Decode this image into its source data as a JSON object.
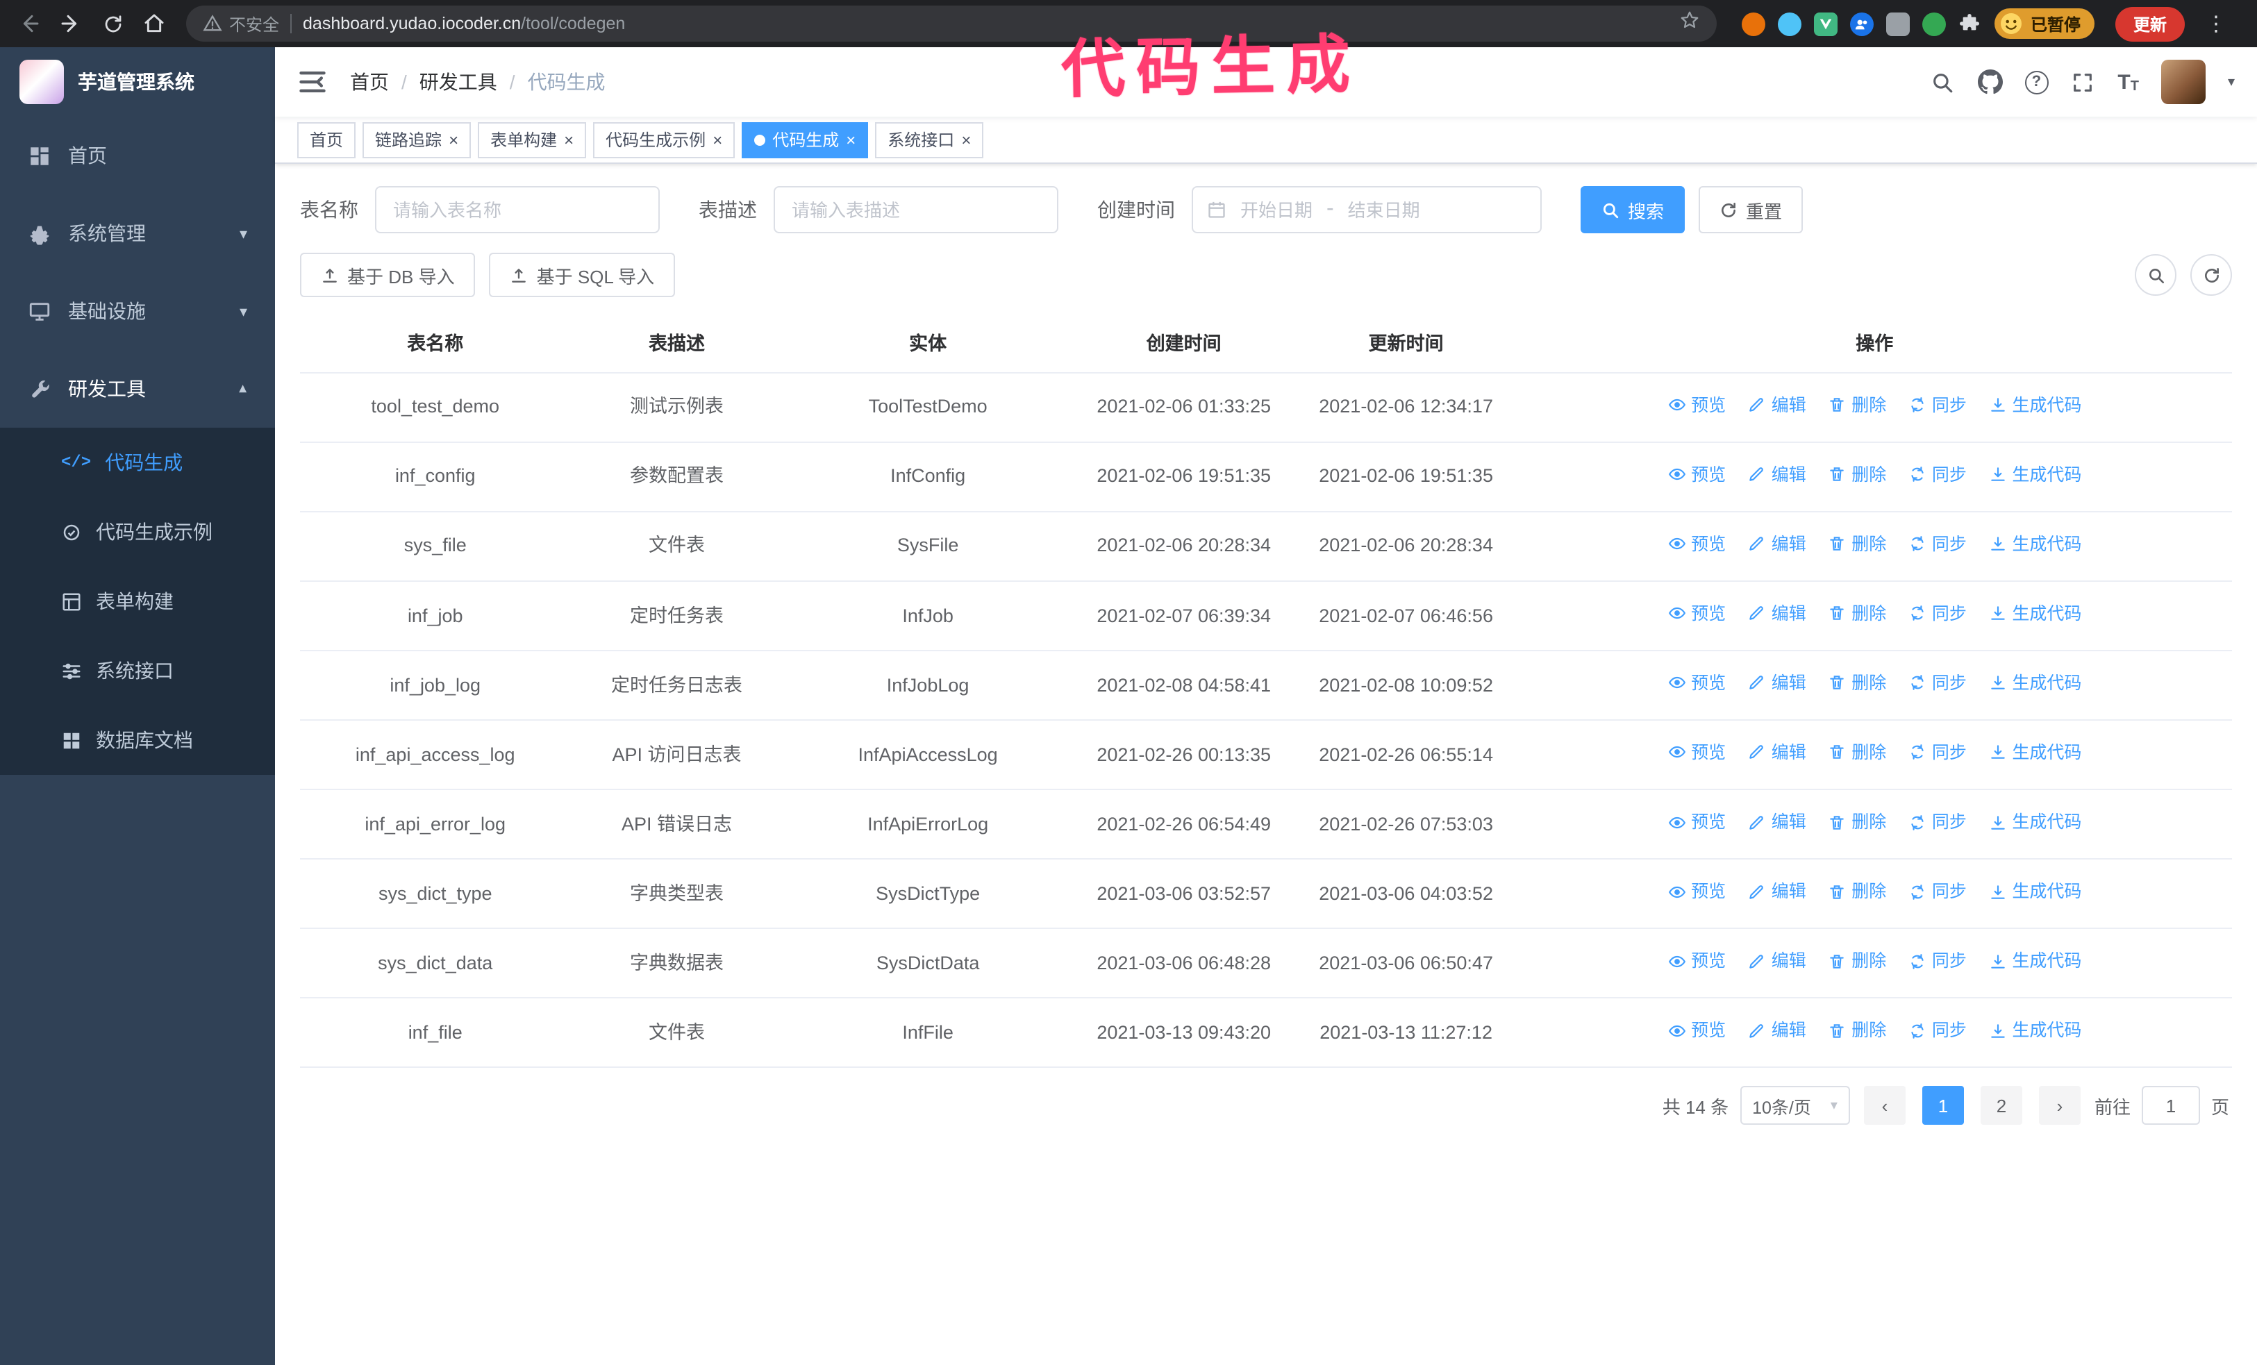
{
  "annotation": {
    "text": "代码生成"
  },
  "icons": {
    "close": "×",
    "kebab": "⋮",
    "caret_down": "▾",
    "code": "</>",
    "question": "?",
    "text_size": "T",
    "prev": "‹",
    "next": "›"
  },
  "browser": {
    "security_label": "不安全",
    "url_domain": "dashboard.yudao.iocoder.cn",
    "url_path": "/tool/codegen",
    "paused_badge": "已暂停",
    "update_button": "更新"
  },
  "sidebar": {
    "logo_title": "芋道管理系统",
    "items": [
      {
        "label": "首页"
      },
      {
        "label": "系统管理"
      },
      {
        "label": "基础设施"
      },
      {
        "label": "研发工具"
      }
    ],
    "submenu": [
      {
        "label": "代码生成"
      },
      {
        "label": "代码生成示例"
      },
      {
        "label": "表单构建"
      },
      {
        "label": "系统接口"
      },
      {
        "label": "数据库文档"
      }
    ]
  },
  "navbar": {
    "breadcrumb": [
      "首页",
      "研发工具",
      "代码生成"
    ],
    "breadcrumb_separator": "/"
  },
  "tags": [
    {
      "label": "首页"
    },
    {
      "label": "链路追踪"
    },
    {
      "label": "表单构建"
    },
    {
      "label": "代码生成示例"
    },
    {
      "label": "代码生成"
    },
    {
      "label": "系统接口"
    }
  ],
  "search_form": {
    "table_name_label": "表名称",
    "table_name_placeholder": "请输入表名称",
    "table_desc_label": "表描述",
    "table_desc_placeholder": "请输入表描述",
    "create_time_label": "创建时间",
    "date_start_placeholder": "开始日期",
    "date_separator": "-",
    "date_end_placeholder": "结束日期",
    "search_button": "搜索",
    "reset_button": "重置"
  },
  "toolbar": {
    "import_db_button": "基于 DB 导入",
    "import_sql_button": "基于 SQL 导入"
  },
  "table": {
    "columns": [
      "表名称",
      "表描述",
      "实体",
      "创建时间",
      "更新时间",
      "操作"
    ],
    "actions": [
      "预览",
      "编辑",
      "删除",
      "同步",
      "生成代码"
    ],
    "rows": [
      {
        "name": "tool_test_demo",
        "desc": "测试示例表",
        "entity": "ToolTestDemo",
        "created": "2021-02-06 01:33:25",
        "updated": "2021-02-06 12:34:17"
      },
      {
        "name": "inf_config",
        "desc": "参数配置表",
        "entity": "InfConfig",
        "created": "2021-02-06 19:51:35",
        "updated": "2021-02-06 19:51:35"
      },
      {
        "name": "sys_file",
        "desc": "文件表",
        "entity": "SysFile",
        "created": "2021-02-06 20:28:34",
        "updated": "2021-02-06 20:28:34"
      },
      {
        "name": "inf_job",
        "desc": "定时任务表",
        "entity": "InfJob",
        "created": "2021-02-07 06:39:34",
        "updated": "2021-02-07 06:46:56"
      },
      {
        "name": "inf_job_log",
        "desc": "定时任务日志表",
        "entity": "InfJobLog",
        "created": "2021-02-08 04:58:41",
        "updated": "2021-02-08 10:09:52"
      },
      {
        "name": "inf_api_access_log",
        "desc": "API 访问日志表",
        "entity": "InfApiAccessLog",
        "created": "2021-02-26 00:13:35",
        "updated": "2021-02-26 06:55:14"
      },
      {
        "name": "inf_api_error_log",
        "desc": "API 错误日志",
        "entity": "InfApiErrorLog",
        "created": "2021-02-26 06:54:49",
        "updated": "2021-02-26 07:53:03"
      },
      {
        "name": "sys_dict_type",
        "desc": "字典类型表",
        "entity": "SysDictType",
        "created": "2021-03-06 03:52:57",
        "updated": "2021-03-06 04:03:52"
      },
      {
        "name": "sys_dict_data",
        "desc": "字典数据表",
        "entity": "SysDictData",
        "created": "2021-03-06 06:48:28",
        "updated": "2021-03-06 06:50:47"
      },
      {
        "name": "inf_file",
        "desc": "文件表",
        "entity": "InfFile",
        "created": "2021-03-13 09:43:20",
        "updated": "2021-03-13 11:27:12"
      }
    ]
  },
  "pagination": {
    "total": "共 14 条",
    "page_size": "10条/页",
    "pages": [
      "1",
      "2"
    ],
    "goto_label": "前往",
    "goto_value": "1",
    "page_label": "页"
  },
  "colors": {
    "accent": "#409eff",
    "sidebar_bg": "#304156",
    "submenu_bg": "#1f2d3d",
    "annotation_pink": "#ff3d71"
  }
}
